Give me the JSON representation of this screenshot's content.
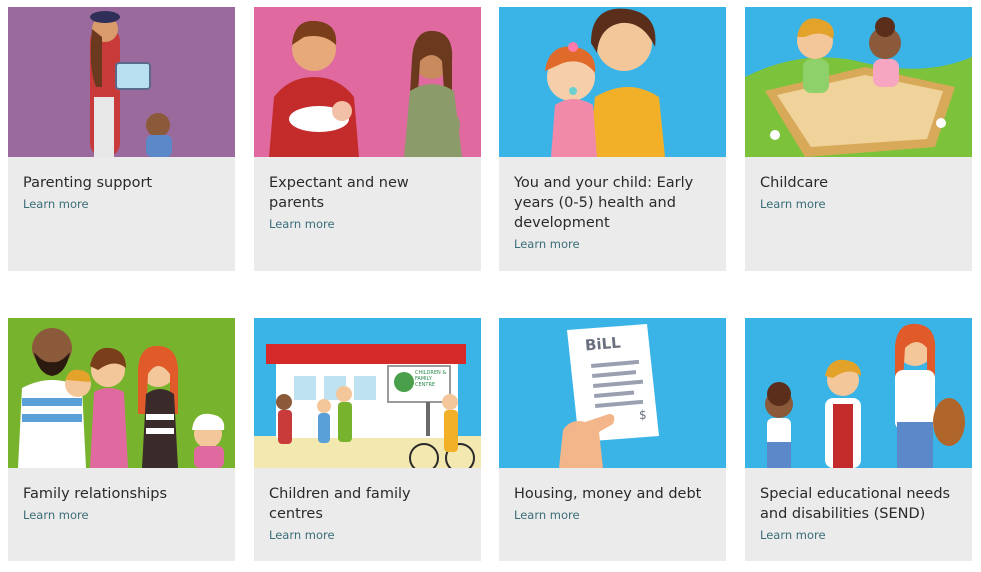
{
  "cards": [
    {
      "title": "Parenting support",
      "link": "Learn more",
      "illustration": "parent-with-tablet-and-child",
      "bg": "#9b6a9c"
    },
    {
      "title": "Expectant and new parents",
      "link": "Learn more",
      "illustration": "father-with-baby-and-pregnant-mother",
      "bg": "#e06aa0"
    },
    {
      "title": "You and your child: Early years (0-5) health and development",
      "link": "Learn more",
      "illustration": "mother-holding-toddler",
      "bg": "#3ab4e6"
    },
    {
      "title": "Childcare",
      "link": "Learn more",
      "illustration": "children-in-sandpit",
      "bg": "#3ab4e6"
    },
    {
      "title": "Family relationships",
      "link": "Learn more",
      "illustration": "family-group",
      "bg": "#78b32e"
    },
    {
      "title": "Children and family centres",
      "link": "Learn more",
      "illustration": "children-centre-building",
      "bg": "#3ab4e6",
      "sign": "CHILDREN & FAMILY CENTRE"
    },
    {
      "title": "Housing, money and debt",
      "link": "Learn more",
      "illustration": "hand-holding-bill",
      "bg": "#3ab4e6",
      "bill_label": "BiLL",
      "bill_symbol": "$"
    },
    {
      "title": "Special educational needs and disabilities (SEND)",
      "link": "Learn more",
      "illustration": "school-children-with-bags",
      "bg": "#3ab4e6"
    }
  ]
}
